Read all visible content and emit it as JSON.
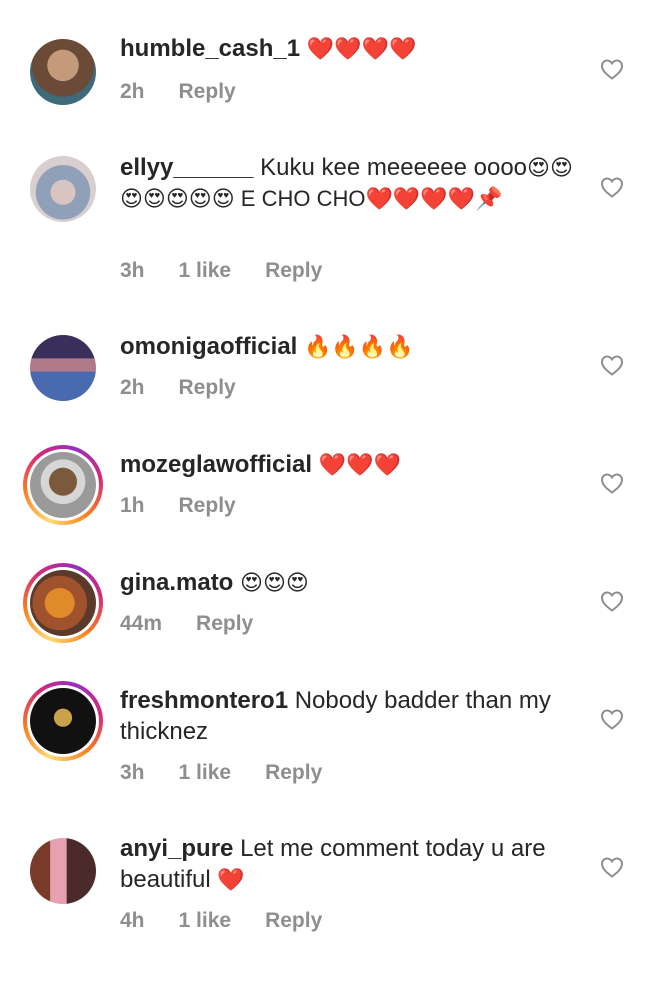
{
  "comments": [
    {
      "username": "humble_cash_1",
      "text": "",
      "emoji": "❤️❤️❤️❤️",
      "time": "2h",
      "likes": "",
      "reply": "Reply",
      "story": false,
      "avatar_color": "#8a6a58"
    },
    {
      "username": "ellyy______",
      "text": "Kuku kee meeeeee oooo",
      "emoji": "😍😍😍😍😍😍😍 E CHO CHO❤️❤️❤️❤️📌",
      "time": "3h",
      "likes": "1 like",
      "reply": "Reply",
      "story": false,
      "avatar_color": "#b9a6a3"
    },
    {
      "username": "omonigaofficial",
      "text": "",
      "emoji": "🔥🔥🔥🔥",
      "time": "2h",
      "likes": "",
      "reply": "Reply",
      "story": false,
      "avatar_color": "#5a4a7a"
    },
    {
      "username": "mozeglawofficial",
      "text": "",
      "emoji": "❤️❤️❤️",
      "time": "1h",
      "likes": "",
      "reply": "Reply",
      "story": true,
      "avatar_color": "#8b6a4a"
    },
    {
      "username": "gina.mato",
      "text": "",
      "emoji": "😍😍😍",
      "time": "44m",
      "likes": "",
      "reply": "Reply",
      "story": true,
      "avatar_color": "#b47a3a"
    },
    {
      "username": "freshmontero1",
      "text": "Nobody badder than my thicknez",
      "emoji": "",
      "time": "3h",
      "likes": "1 like",
      "reply": "Reply",
      "story": true,
      "avatar_color": "#1a1a1a"
    },
    {
      "username": "anyi_pure",
      "text": "Let me comment today u are beautiful",
      "emoji": "❤️",
      "time": "4h",
      "likes": "1 like",
      "reply": "Reply",
      "story": false,
      "avatar_color": "#7a4a3a"
    }
  ]
}
